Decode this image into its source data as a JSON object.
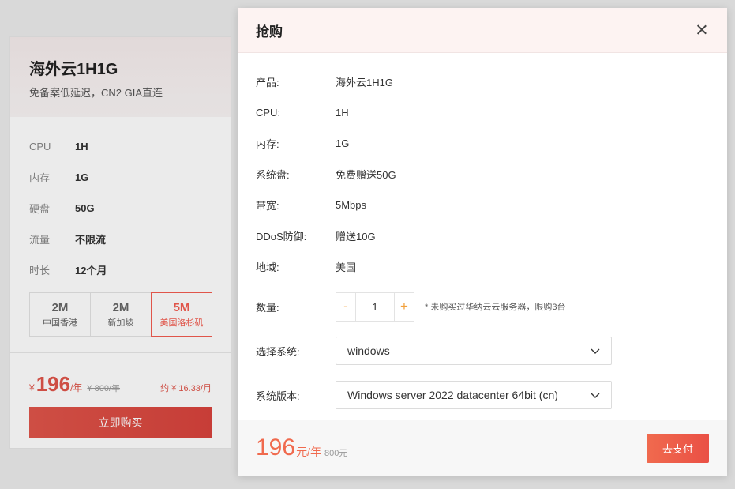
{
  "card": {
    "title": "海外云1H1G",
    "subtitle": "免备案低延迟，CN2 GIA直连",
    "specs": [
      {
        "label": "CPU",
        "value": "1H"
      },
      {
        "label": "内存",
        "value": "1G"
      },
      {
        "label": "硬盘",
        "value": "50G"
      },
      {
        "label": "流量",
        "value": "不限流"
      },
      {
        "label": "时长",
        "value": "12个月"
      }
    ],
    "bandwidth_options": [
      {
        "big": "2M",
        "small": "中国香港",
        "active": false
      },
      {
        "big": "2M",
        "small": "新加坡",
        "active": false
      },
      {
        "big": "5M",
        "small": "美国洛杉矶",
        "active": true
      }
    ],
    "price": {
      "currency": "¥",
      "amount": "196",
      "unit": "/年",
      "original": "¥ 800/年",
      "monthly": "约 ¥ 16.33/月"
    },
    "buy_label": "立即购买"
  },
  "modal": {
    "title": "抢购",
    "info": [
      {
        "label": "产品:",
        "value": "海外云1H1G"
      },
      {
        "label": "CPU:",
        "value": "1H"
      },
      {
        "label": "内存:",
        "value": "1G"
      },
      {
        "label": "系统盘:",
        "value": "免费赠送50G"
      },
      {
        "label": "带宽:",
        "value": "5Mbps"
      },
      {
        "label": "DDoS防御:",
        "value": "赠送10G"
      },
      {
        "label": "地域:",
        "value": "美国"
      }
    ],
    "quantity": {
      "label": "数量:",
      "value": "1",
      "minus": "-",
      "plus": "+",
      "note": "* 未购买过华纳云云服务器，限购3台"
    },
    "os": {
      "label": "选择系统:",
      "value": "windows"
    },
    "version": {
      "label": "系统版本:",
      "value": "Windows server 2022 datacenter 64bit (cn)"
    },
    "footer": {
      "price": "196",
      "unit": "元/年",
      "original": "800元",
      "pay_label": "去支付"
    }
  },
  "colors": {
    "accent": "#e0554a",
    "pay": "#f06a4e",
    "stepper": "#f2a03a"
  }
}
